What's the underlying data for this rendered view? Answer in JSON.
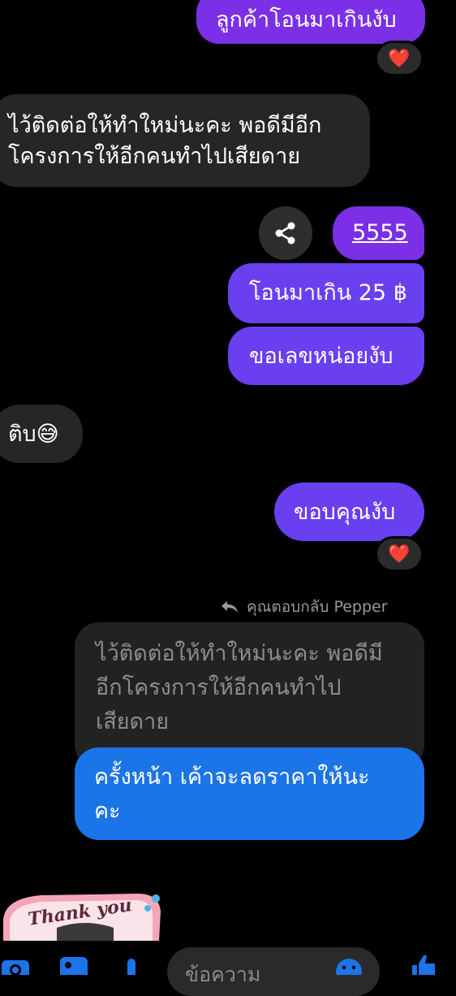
{
  "messages": {
    "m1": "ลูกค้าโอนมาเกินงับ",
    "m2_line1": "ไว้ติดต่อให้ทำใหม่นะคะ พอดีมีอีก",
    "m2_line2": "โครงการให้อีกคนทำไปเสียดาย",
    "m3": "5555",
    "m4": "โอนมาเกิน 25 ฿",
    "m5": "ขอเลขหน่อยงับ",
    "m6": "ติบ😅",
    "m7": "ขอบคุณงับ"
  },
  "reactions": {
    "heart": "❤️"
  },
  "reply": {
    "label": "คุณตอบกลับ Pepper",
    "quoted_line1": "ไว้ติดต่อให้ทำใหม่นะคะ พอดีมี",
    "quoted_line2": "อีกโครงการให้อีกคนทำไป",
    "quoted_line3": "เสียดาย",
    "text_line1": "ครั้งหน้า เค้าจะลดราคาให้นะ",
    "text_line2": "คะ"
  },
  "sticker": {
    "text": "Thank you"
  },
  "composer": {
    "placeholder": "ข้อความ"
  },
  "colors": {
    "outgoing_purple": "#7b2fe6",
    "outgoing_violet": "#6a3ff0",
    "incoming_gray": "#262626",
    "reply_blue": "#1b74e8",
    "accent_blue": "#1b74e8"
  },
  "icons": [
    "share-icon",
    "heart-icon",
    "reply-arrow-icon",
    "camera-icon",
    "image-icon",
    "microphone-icon",
    "emoji-icon",
    "thumbs-up-icon"
  ]
}
